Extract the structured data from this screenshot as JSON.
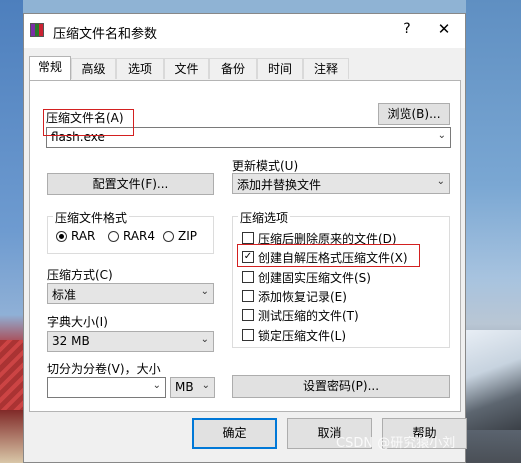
{
  "window": {
    "title": "压缩文件名和参数",
    "help": "?",
    "close": "✕"
  },
  "tabs": [
    "常规",
    "高级",
    "选项",
    "文件",
    "备份",
    "时间",
    "注释"
  ],
  "general": {
    "archive_name_label": "压缩文件名(A)",
    "browse_button": "浏览(B)...",
    "archive_name_value": "flash.exe",
    "profiles_button": "配置文件(F)...",
    "update_mode_label": "更新模式(U)",
    "update_mode_value": "添加并替换文件",
    "format_group": "压缩文件格式",
    "formats": [
      "RAR",
      "RAR4",
      "ZIP"
    ],
    "format_selected": "RAR",
    "method_label": "压缩方式(C)",
    "method_value": "标准",
    "dict_label": "字典大小(I)",
    "dict_value": "32 MB",
    "split_label": "切分为分卷(V)，大小",
    "split_value": "",
    "split_unit": "MB",
    "options_group": "压缩选项",
    "options": [
      {
        "label": "压缩后删除原来的文件(D)",
        "checked": false
      },
      {
        "label": "创建自解压格式压缩文件(X)",
        "checked": true
      },
      {
        "label": "创建固实压缩文件(S)",
        "checked": false
      },
      {
        "label": "添加恢复记录(E)",
        "checked": false
      },
      {
        "label": "测试压缩的文件(T)",
        "checked": false
      },
      {
        "label": "锁定压缩文件(L)",
        "checked": false
      }
    ],
    "password_button": "设置密码(P)..."
  },
  "footer": {
    "ok": "确定",
    "cancel": "取消",
    "help": "帮助"
  },
  "watermark": "CSDN @研究猿小刘"
}
